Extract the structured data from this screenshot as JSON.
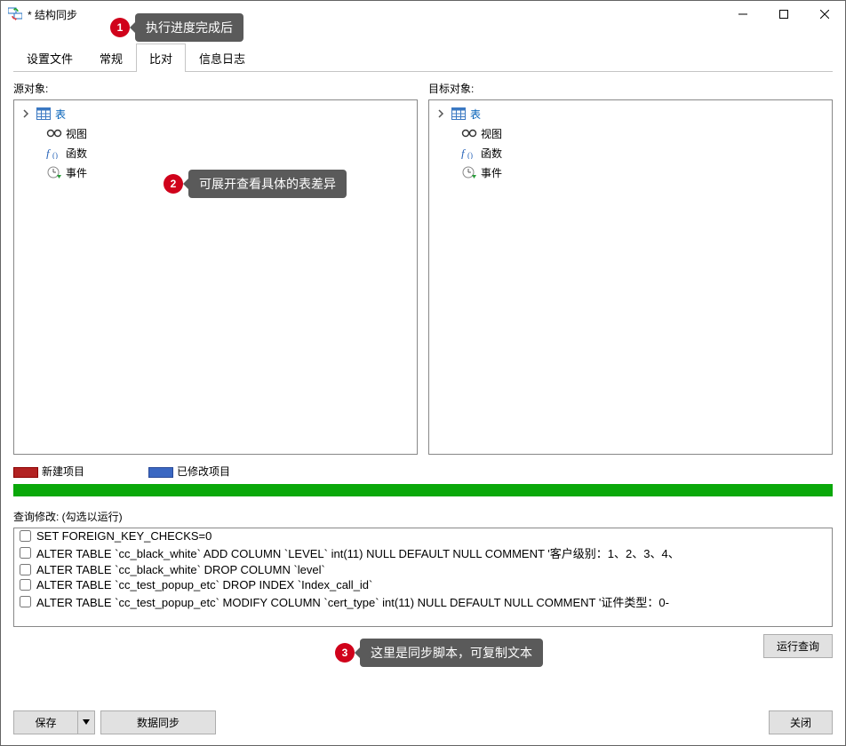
{
  "window": {
    "title": "* 结构同步",
    "min": "–",
    "max": "☐",
    "close": "✕"
  },
  "callouts": {
    "c1": {
      "num": "1",
      "text": "执行进度完成后"
    },
    "c2": {
      "num": "2",
      "text": "可展开查看具体的表差异"
    },
    "c3": {
      "num": "3",
      "text": "这里是同步脚本，可复制文本"
    }
  },
  "tabs": [
    "设置文件",
    "常规",
    "比对",
    "信息日志"
  ],
  "active_tab_index": 2,
  "panels": {
    "source": {
      "title": "源对象:",
      "nodes": [
        "表",
        "视图",
        "函数",
        "事件"
      ]
    },
    "target": {
      "title": "目标对象:",
      "nodes": [
        "表",
        "视图",
        "函数",
        "事件"
      ]
    }
  },
  "legend": {
    "new_label": "新建项目",
    "mod_label": "已修改项目"
  },
  "query": {
    "title": "查询修改: (勾选以运行)",
    "rows": [
      "SET FOREIGN_KEY_CHECKS=0",
      "ALTER TABLE `cc_black_white` ADD COLUMN `LEVEL` int(11) NULL DEFAULT NULL COMMENT '客户级别：1、2、3、4、",
      "ALTER TABLE `cc_black_white` DROP COLUMN `level`",
      "ALTER TABLE `cc_test_popup_etc` DROP INDEX `Index_call_id`",
      "ALTER TABLE `cc_test_popup_etc` MODIFY COLUMN `cert_type` int(11) NULL DEFAULT NULL COMMENT '证件类型：0-"
    ],
    "run_label": "运行查询"
  },
  "footer": {
    "save": "保存",
    "save_arrow": "▼",
    "sync": "数据同步",
    "close": "关闭"
  }
}
